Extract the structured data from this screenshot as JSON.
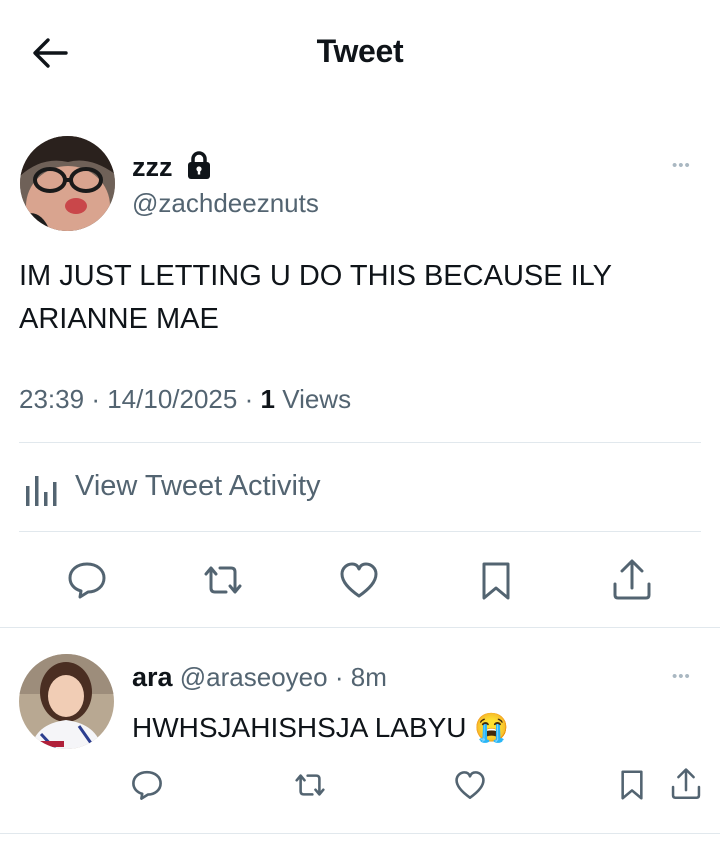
{
  "header": {
    "title": "Tweet"
  },
  "tweet": {
    "display_name": "zzz",
    "handle": "@zachdeeznuts",
    "text_line1": "IM JUST LETTING U DO THIS BECAUSE ILY",
    "text_line2": "ARIANNE MAE",
    "time": "23:39",
    "date": "14/10/2025",
    "views_count": "1",
    "views_label": "Views",
    "separator": "·",
    "activity_label": "View Tweet Activity",
    "more": "•••"
  },
  "reply": {
    "display_name": "ara",
    "handle": "@araseoyeo",
    "separator": "·",
    "age": "8m",
    "text": "HWHSJAHISHSJA LABYU",
    "emoji": "😭",
    "more": "•••"
  },
  "icons": {
    "back": "arrow-left-icon",
    "lock": "lock-icon",
    "stats": "bar-chart-icon",
    "reply": "comment-icon",
    "retweet": "retweet-icon",
    "like": "heart-icon",
    "bookmark": "bookmark-icon",
    "share": "share-icon"
  },
  "colors": {
    "text": "#0f1419",
    "secondary": "#536471",
    "divider": "#e1e8ed"
  }
}
